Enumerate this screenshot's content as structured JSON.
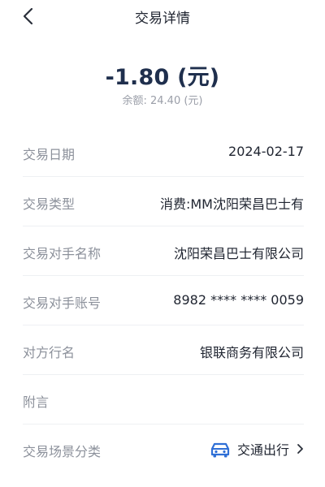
{
  "header": {
    "title": "交易详情",
    "back_icon": "chevron-left-icon"
  },
  "summary": {
    "amount": "-1.80 (元)",
    "balance": "余额: 24.40 (元)"
  },
  "details": [
    {
      "label": "交易日期",
      "value": "2024-02-17"
    },
    {
      "label": "交易类型",
      "value": "消费:MM沈阳荣昌巴士有"
    },
    {
      "label": "交易对手名称",
      "value": "沈阳荣昌巴士有限公司"
    },
    {
      "label": "交易对手账号",
      "value": "8982 **** **** 0059"
    },
    {
      "label": "对方行名",
      "value": "银联商务有限公司"
    },
    {
      "label": "附言",
      "value": ""
    }
  ],
  "scene": {
    "label": "交易场景分类",
    "value": "交通出行",
    "icon": "car-icon",
    "icon_color": "#2f6fd6"
  }
}
